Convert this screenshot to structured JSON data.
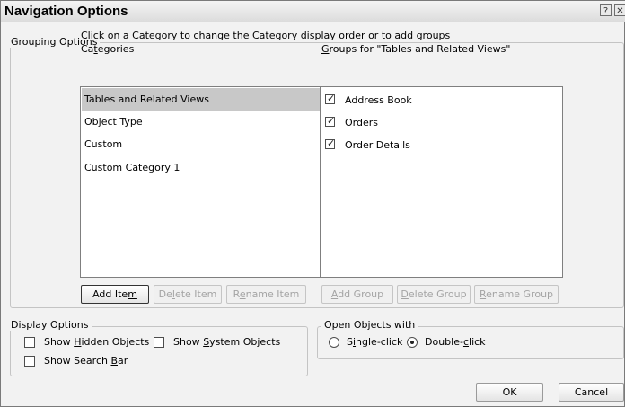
{
  "window": {
    "title": "Navigation Options",
    "help_glyph": "?",
    "close_glyph": "✕"
  },
  "grouping": {
    "legend": "Grouping Options",
    "instruction": "Click on a Category to change the Category display order or to add groups",
    "categories_label": "Categories",
    "categories": [
      {
        "label": "Tables and Related Views",
        "selected": true
      },
      {
        "label": "Object Type",
        "selected": false
      },
      {
        "label": "Custom",
        "selected": false
      },
      {
        "label": "Custom Category 1",
        "selected": false
      }
    ],
    "groups_label": "Groups for \"Tables and Related Views\"",
    "groups": [
      {
        "label": "Address Book",
        "checked": true
      },
      {
        "label": "Orders",
        "checked": true
      },
      {
        "label": "Order Details",
        "checked": true
      }
    ],
    "buttons": {
      "add_item": "Add Item",
      "delete_item": "Delete Item",
      "rename_item": "Rename Item",
      "add_group": "Add Group",
      "delete_group": "Delete Group",
      "rename_group": "Rename Group"
    }
  },
  "display": {
    "legend": "Display Options",
    "show_hidden": {
      "label": "Show Hidden Objects",
      "checked": false
    },
    "show_system": {
      "label": "Show System Objects",
      "checked": false
    },
    "show_search": {
      "label": "Show Search Bar",
      "checked": false
    }
  },
  "open_objects": {
    "legend": "Open Objects with",
    "single_click": {
      "label": "Single-click",
      "selected": false
    },
    "double_click": {
      "label": "Double-click",
      "selected": true
    }
  },
  "footer": {
    "ok": "OK",
    "cancel": "Cancel"
  }
}
